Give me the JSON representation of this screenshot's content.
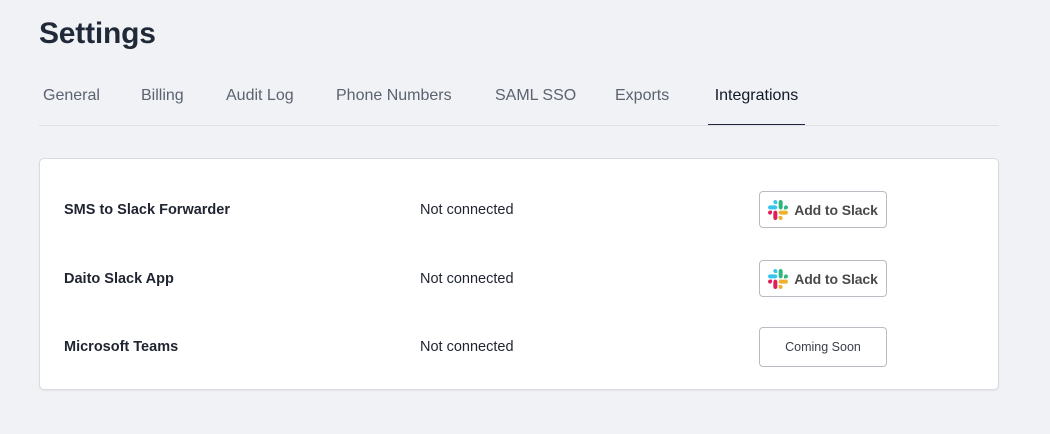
{
  "page": {
    "title": "Settings"
  },
  "tabs": [
    {
      "label": "General",
      "active": false
    },
    {
      "label": "Billing",
      "active": false
    },
    {
      "label": "Audit Log",
      "active": false
    },
    {
      "label": "Phone Numbers",
      "active": false
    },
    {
      "label": "SAML SSO",
      "active": false
    },
    {
      "label": "Exports",
      "active": false
    },
    {
      "label": "Integrations",
      "active": true
    }
  ],
  "integrations": [
    {
      "name": "SMS to Slack Forwarder",
      "status": "Not connected",
      "action_label": "Add to Slack",
      "action_icon": "slack-icon"
    },
    {
      "name": "Daito Slack App",
      "status": "Not connected",
      "action_label": "Add to Slack",
      "action_icon": "slack-icon"
    },
    {
      "name": "Microsoft Teams",
      "status": "Not connected",
      "action_label": "Coming Soon"
    }
  ],
  "colors": {
    "background": "#f1f2f5",
    "active_tab_underline": "#1f2540",
    "slack_blue": "#36C5F0",
    "slack_green": "#2EB67D",
    "slack_yellow": "#ECB22E",
    "slack_red": "#E01E5A"
  }
}
